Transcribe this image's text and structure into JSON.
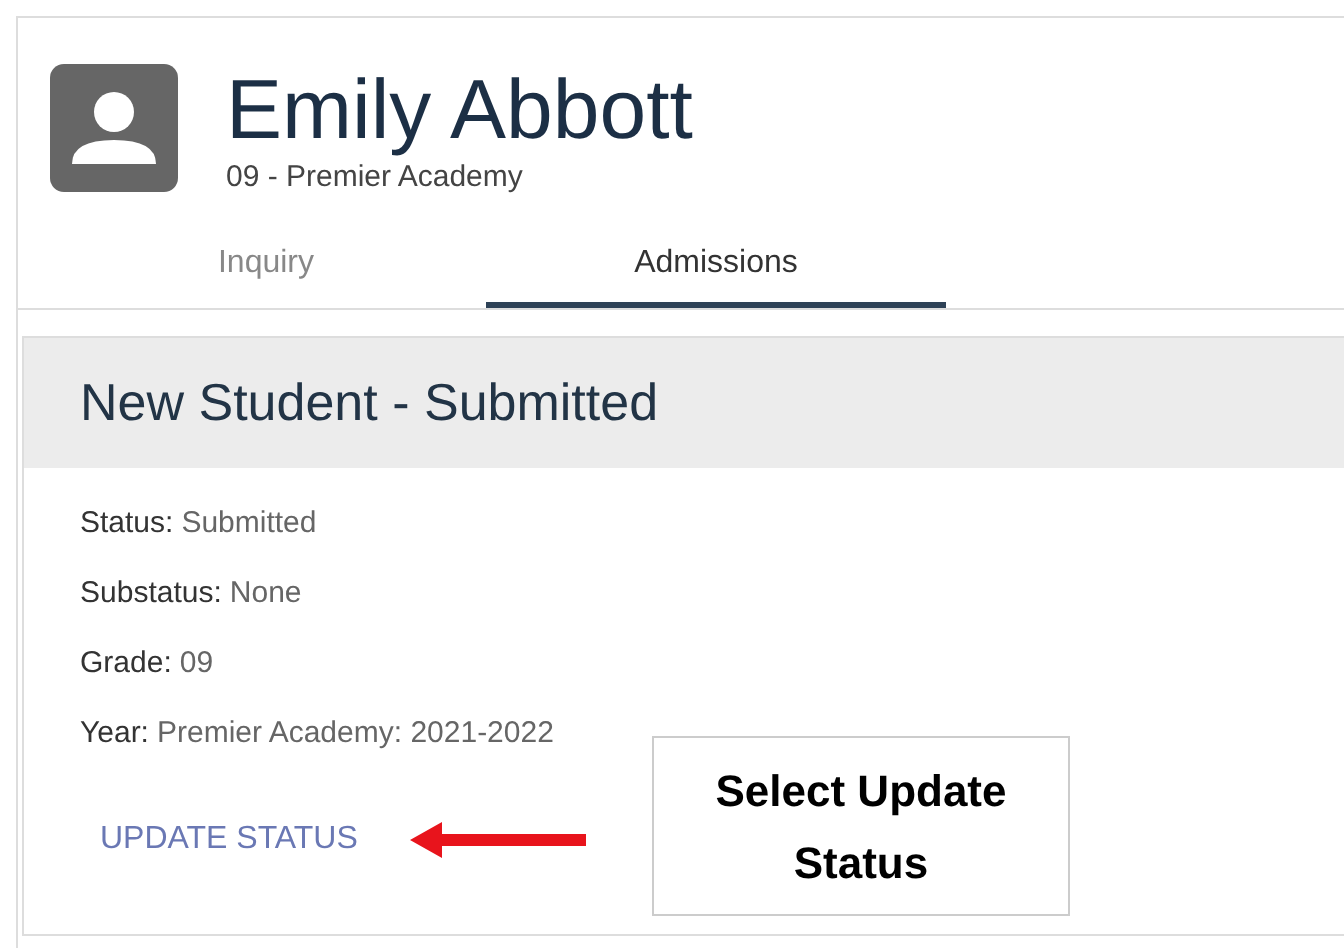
{
  "student": {
    "name": "Emily Abbott",
    "subtitle": "09 - Premier Academy"
  },
  "tabs": [
    {
      "label": "Inquiry",
      "selected": false
    },
    {
      "label": "Admissions",
      "selected": true
    }
  ],
  "card": {
    "title": "New Student - Submitted",
    "fields": [
      {
        "label": "Status:",
        "value": "Submitted"
      },
      {
        "label": "Substatus:",
        "value": "None"
      },
      {
        "label": "Grade:",
        "value": "09"
      },
      {
        "label": "Year:",
        "value": "Premier Academy: 2021-2022"
      }
    ],
    "action": "UPDATE STATUS"
  },
  "callout": {
    "text": "Select Update Status"
  }
}
